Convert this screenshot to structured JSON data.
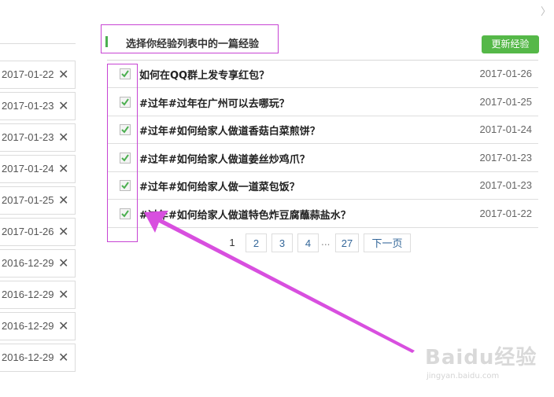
{
  "left_list": {
    "items": [
      {
        "date": "2017-01-22",
        "remove_icon": "close-icon"
      },
      {
        "date": "2017-01-23",
        "remove_icon": "close-icon"
      },
      {
        "date": "2017-01-23",
        "remove_icon": "close-icon"
      },
      {
        "date": "2017-01-24",
        "remove_icon": "close-icon"
      },
      {
        "date": "2017-01-25",
        "remove_icon": "close-icon"
      },
      {
        "date": "2017-01-26",
        "remove_icon": "close-icon"
      },
      {
        "date": "2016-12-29",
        "remove_icon": "close-icon"
      },
      {
        "date": "2016-12-29",
        "remove_icon": "close-icon"
      },
      {
        "date": "2016-12-29",
        "remove_icon": "close-icon"
      },
      {
        "date": "2016-12-29",
        "remove_icon": "close-icon"
      }
    ],
    "remove_glyph": "✕"
  },
  "dialog": {
    "close_glyph": "〉",
    "title": "选择你经验列表中的一篇经验",
    "update_button": "更新经验",
    "accent_color": "#55b848",
    "highlight_color": "#c744d3",
    "articles": [
      {
        "title": "如何在QQ群上发专享红包？",
        "date": "2017-01-26",
        "checked": true
      },
      {
        "title": "#过年#过年在广州可以去哪玩？",
        "date": "2017-01-25",
        "checked": true
      },
      {
        "title": "#过年#如何给家人做道香菇白菜煎饼？",
        "date": "2017-01-24",
        "checked": true
      },
      {
        "title": "#过年#如何给家人做道姜丝炒鸡爪？",
        "date": "2017-01-23",
        "checked": true
      },
      {
        "title": "#过年#如何给家人做一道菜包饭？",
        "date": "2017-01-23",
        "checked": true
      },
      {
        "title": "#过年#如何给家人做道特色炸豆腐蘸蒜盐水？",
        "date": "2017-01-22",
        "checked": true
      }
    ],
    "pagination": {
      "current": "1",
      "pages": [
        "2",
        "3",
        "4"
      ],
      "ellipsis": "...",
      "last": "27",
      "next": "下一页"
    }
  },
  "watermark": {
    "logo": "Baidu经验",
    "url": "jingyan.baidu.com"
  }
}
